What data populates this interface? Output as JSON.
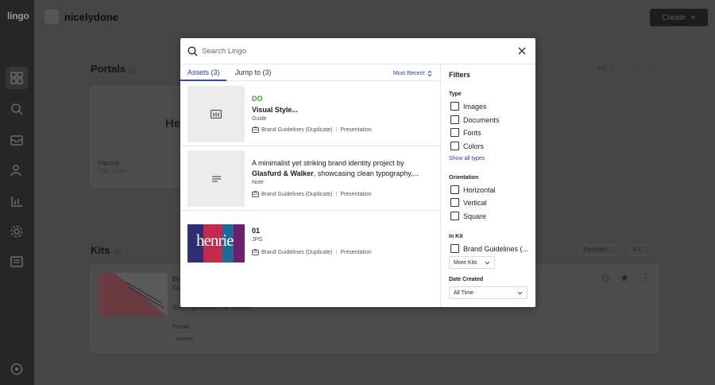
{
  "app": {
    "logo": "lingo",
    "workspace": "nicelydone",
    "create_label": "Create"
  },
  "background": {
    "portals": {
      "title": "Portals",
      "count": "(1)",
      "sort": "A-Z"
    },
    "portal_card": {
      "big_text": "He",
      "name": "Henrie",
      "meta": "1 kit · 1 item"
    },
    "kits": {
      "title": "Kits",
      "count": "(1)",
      "filter": "Favorites",
      "sort": "A-Z"
    },
    "kit_card": {
      "name_partial": "Br",
      "line1": "Fa",
      "line2": "Brand guidelines for Henrie",
      "portals_label": "Portals",
      "portal_tag": "Henrie"
    }
  },
  "modal": {
    "search": {
      "placeholder": "Search Lingo",
      "value": ""
    },
    "tabs": [
      {
        "label": "Assets (3)",
        "active": true
      },
      {
        "label": "Jump to (3)",
        "active": false
      }
    ],
    "sort_label": "Most Recent",
    "results": [
      {
        "type_label": "DO",
        "type_color": "#3aa335",
        "title": "Visual Style...",
        "subtitle": "Guide",
        "kit": "Brand Guidelines (Duplicate)",
        "kit_type": "Presentation",
        "thumb_icon": "guide-icon"
      },
      {
        "line1": "A minimalist yet striking brand identity project by",
        "line2_bold": "Glasfurd & Walker",
        "line2_rest": ", showcasing clean typography,...",
        "subtitle": "Note",
        "kit": "Brand Guidelines (Duplicate)",
        "kit_type": "Presentation",
        "thumb_icon": "note-icon"
      },
      {
        "title": "01",
        "subtitle": "JPG",
        "kit": "Brand Guidelines (Duplicate)",
        "kit_type": "Presentation",
        "thumb_text": "henrie"
      }
    ],
    "filters": {
      "title": "Filters",
      "type": {
        "heading": "Type",
        "options": [
          "Images",
          "Documents",
          "Fonts",
          "Colors"
        ],
        "show_all": "Show all types"
      },
      "orientation": {
        "heading": "Orientation",
        "options": [
          "Horizontal",
          "Vertical",
          "Square"
        ]
      },
      "in_kit": {
        "heading": "In Kit",
        "options": [
          "Brand Guidelines (..."
        ],
        "more_label": "More Kits"
      },
      "date_created": {
        "heading": "Date Created",
        "value": "All Time"
      }
    }
  }
}
